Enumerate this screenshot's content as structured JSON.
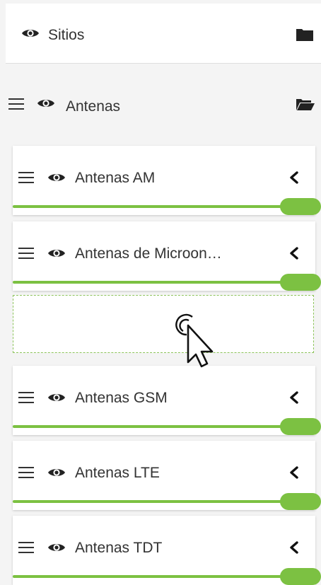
{
  "colors": {
    "accent": "#7cc142",
    "icon": "#222222"
  },
  "groups": [
    {
      "label": "Sitios",
      "icon": "folder-closed-icon"
    },
    {
      "label": "Antenas",
      "icon": "folder-open-icon"
    }
  ],
  "layers": [
    {
      "label": "Antenas AM",
      "opacity": 1.0
    },
    {
      "label": "Antenas de Microon…",
      "opacity": 1.0
    },
    {
      "label": "Antenas GSM",
      "opacity": 1.0
    },
    {
      "label": "Antenas LTE",
      "opacity": 1.0
    },
    {
      "label": "Antenas TDT",
      "opacity": 1.0
    }
  ]
}
